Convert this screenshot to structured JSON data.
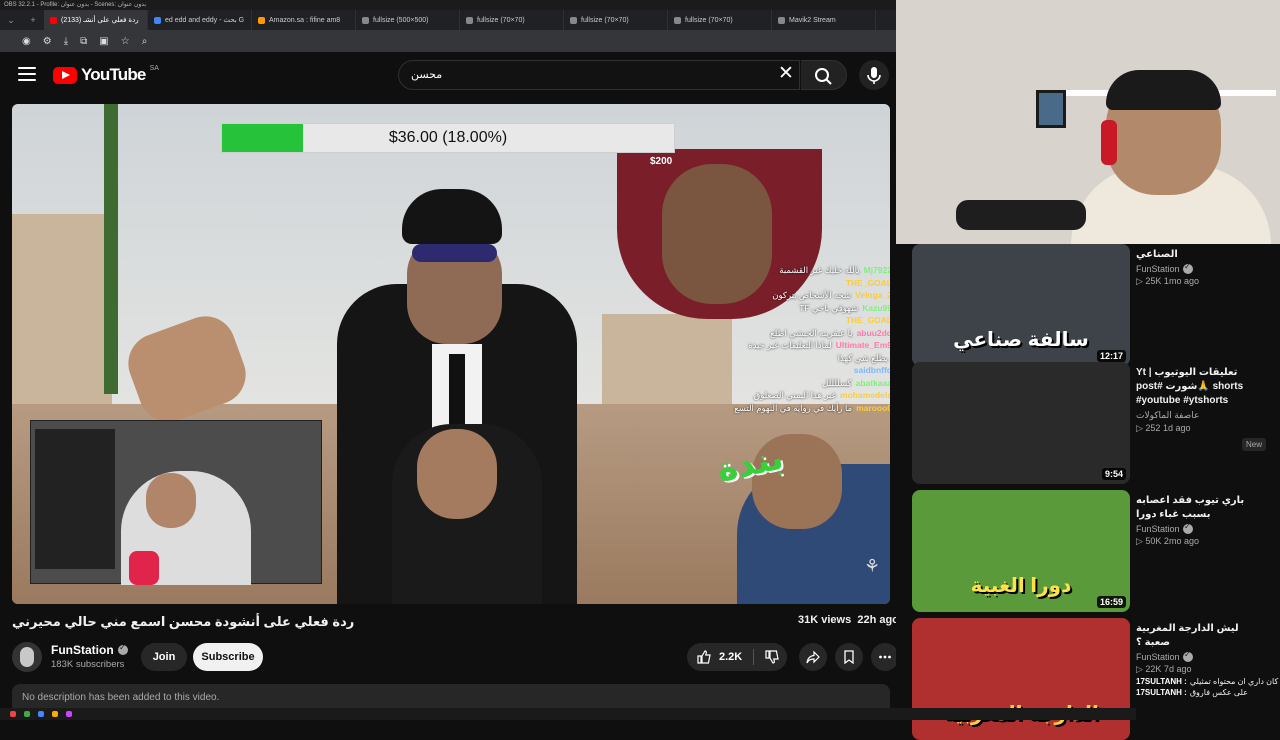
{
  "obs_title": "OBS 32.2.1 - Profile: بدون عنوان - Scenes: بدون عنوان",
  "browser": {
    "tabs": [
      {
        "label": "ردة فعلي على أنشـ (2133)",
        "active": true,
        "color": "#ff0000"
      },
      {
        "label": "ed edd and eddy - بحث G",
        "active": false,
        "color": "#4285f4"
      },
      {
        "label": "Amazon.sa : fifine am8",
        "active": false,
        "color": "#ff9900"
      },
      {
        "label": "fullsize (500×500)",
        "active": false,
        "color": "#888888"
      },
      {
        "label": "fullsize (70×70)",
        "active": false,
        "color": "#888888"
      },
      {
        "label": "fullsize (70×70)",
        "active": false,
        "color": "#888888"
      },
      {
        "label": "fullsize (70×70)",
        "active": false,
        "color": "#888888"
      },
      {
        "label": "Mavik2 Stream",
        "active": false,
        "color": "#888888"
      }
    ]
  },
  "header": {
    "logo_text": "YouTube",
    "region": "SA",
    "search_value": "محسن"
  },
  "player": {
    "progress_text": "$36.00 (18.00%)",
    "progress_fraction": 0.18,
    "price_tag": "$200",
    "big_word": "بندة",
    "chat": [
      {
        "user": "Mj7922",
        "msg": "يالله خليك غير القشمبة",
        "color": "#7ef07e"
      },
      {
        "user": "THE_GOAL",
        "msg": "",
        "color": "#ffcc33"
      },
      {
        "user": "Velnga_2",
        "msg": "شحه الأشخاص يتركون",
        "color": "#ffcc33"
      },
      {
        "user": "Kazu99",
        "msg": "TF شهوقي ياخي",
        "color": "#7ef07e"
      },
      {
        "user": "THE_GOAL",
        "msg": "",
        "color": "#ffcc33"
      },
      {
        "user": "abuu2dd",
        "msg": "يا عبقرينه الحبشي اطلع",
        "color": "#ff7aa8"
      },
      {
        "user": "Ultimate_Em9",
        "msg": "لماذا التعليقات غير جيدة",
        "color": "#ff7aa8"
      },
      {
        "user": "",
        "msg": "يطلع شي كهذا",
        "color": "#ffffff"
      },
      {
        "user": "saidbnffd",
        "msg": "",
        "color": "#7ab8ff"
      },
      {
        "user": "abatkaaa",
        "msg": "كسللللل",
        "color": "#7ef07e"
      },
      {
        "user": "mohamedels",
        "msg": "غير هذا اليمني الصعلوق",
        "color": "#ffcc33"
      },
      {
        "user": "marooo0",
        "msg": "ما رأيك في رواية في النهوم التسع",
        "color": "#ffcc33"
      }
    ]
  },
  "video": {
    "title": "ردة فعلي على أنشودة محسن اسمع مني حالي محيرني",
    "views": "31K views",
    "age": "22h ago",
    "channel": "FunStation",
    "subscribers": "183K subscribers",
    "join_label": "Join",
    "subscribe_label": "Subscribe",
    "likes": "2.2K",
    "description": "No description has been added to this video."
  },
  "sidebar": {
    "items": [
      {
        "title": "الصناعي",
        "channel": "FunStation",
        "meta": "▷ 25K   1mo ago",
        "duration": "12:17",
        "badge": "",
        "caption": "سالفة صناعي",
        "caption_color": "#ffffff",
        "bg": "#3d4348"
      },
      {
        "title": "تعليقات اليوتيوب | Yt shorts 🙏شورت #post #youtube #ytshorts",
        "channel": "عاصفة الماكولات",
        "meta": "▷ 252   1d ago",
        "duration": "9:54",
        "badge": "New",
        "caption": "",
        "caption_color": "#ffffff",
        "bg": "#2a2a2a"
      },
      {
        "title": "باري تيوب فقد اعصابه بسبب غباء دورا",
        "channel": "FunStation",
        "meta": "▷ 50K   2mo ago",
        "duration": "16:59",
        "badge": "",
        "caption": "دورا الغبية",
        "caption_color": "#ffe14a",
        "bg": "#5a9a3a"
      },
      {
        "title": "ليش الدارجة المغربية صعبة ؟",
        "channel": "FunStation",
        "meta": "▷ 22K   7d ago",
        "duration": "",
        "badge": "",
        "caption": "الدارجة المغربية",
        "caption_color": "#ffd23a",
        "bg": "#b03030"
      }
    ]
  },
  "side_chat": [
    {
      "user": "17SULTANH :",
      "msg": "لاز كان داري ان محتواه تمثيلي"
    },
    {
      "user": "17SULTANH :",
      "msg": "على عكس فاروق"
    }
  ]
}
